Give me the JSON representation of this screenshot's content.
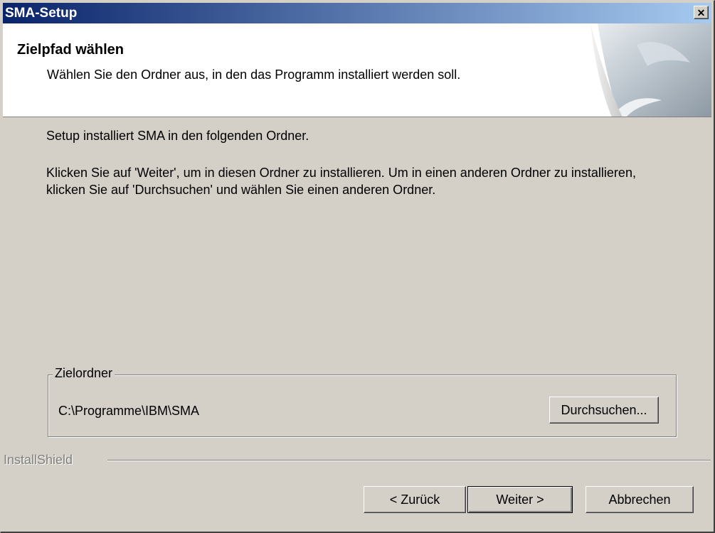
{
  "window": {
    "title": "SMA-Setup"
  },
  "header": {
    "title": "Zielpfad wählen",
    "subtitle": "Wählen Sie den Ordner aus, in den das Programm installiert werden soll."
  },
  "body": {
    "line1": "Setup installiert SMA in den folgenden Ordner.",
    "line2": "Klicken Sie auf 'Weiter', um in diesen Ordner zu installieren. Um in einen anderen Ordner zu installieren, klicken Sie auf 'Durchsuchen' und wählen Sie einen anderen Ordner."
  },
  "destination": {
    "group_label": "Zielordner",
    "path": "C:\\Programme\\IBM\\SMA",
    "browse_label": "Durchsuchen..."
  },
  "footer": {
    "brand": "InstallShield",
    "back_label": "< Zurück",
    "next_label": "Weiter >",
    "cancel_label": "Abbrechen"
  },
  "colors": {
    "titlebar_start": "#0a246a",
    "titlebar_end": "#a6caf0",
    "face": "#d4d0c8"
  }
}
